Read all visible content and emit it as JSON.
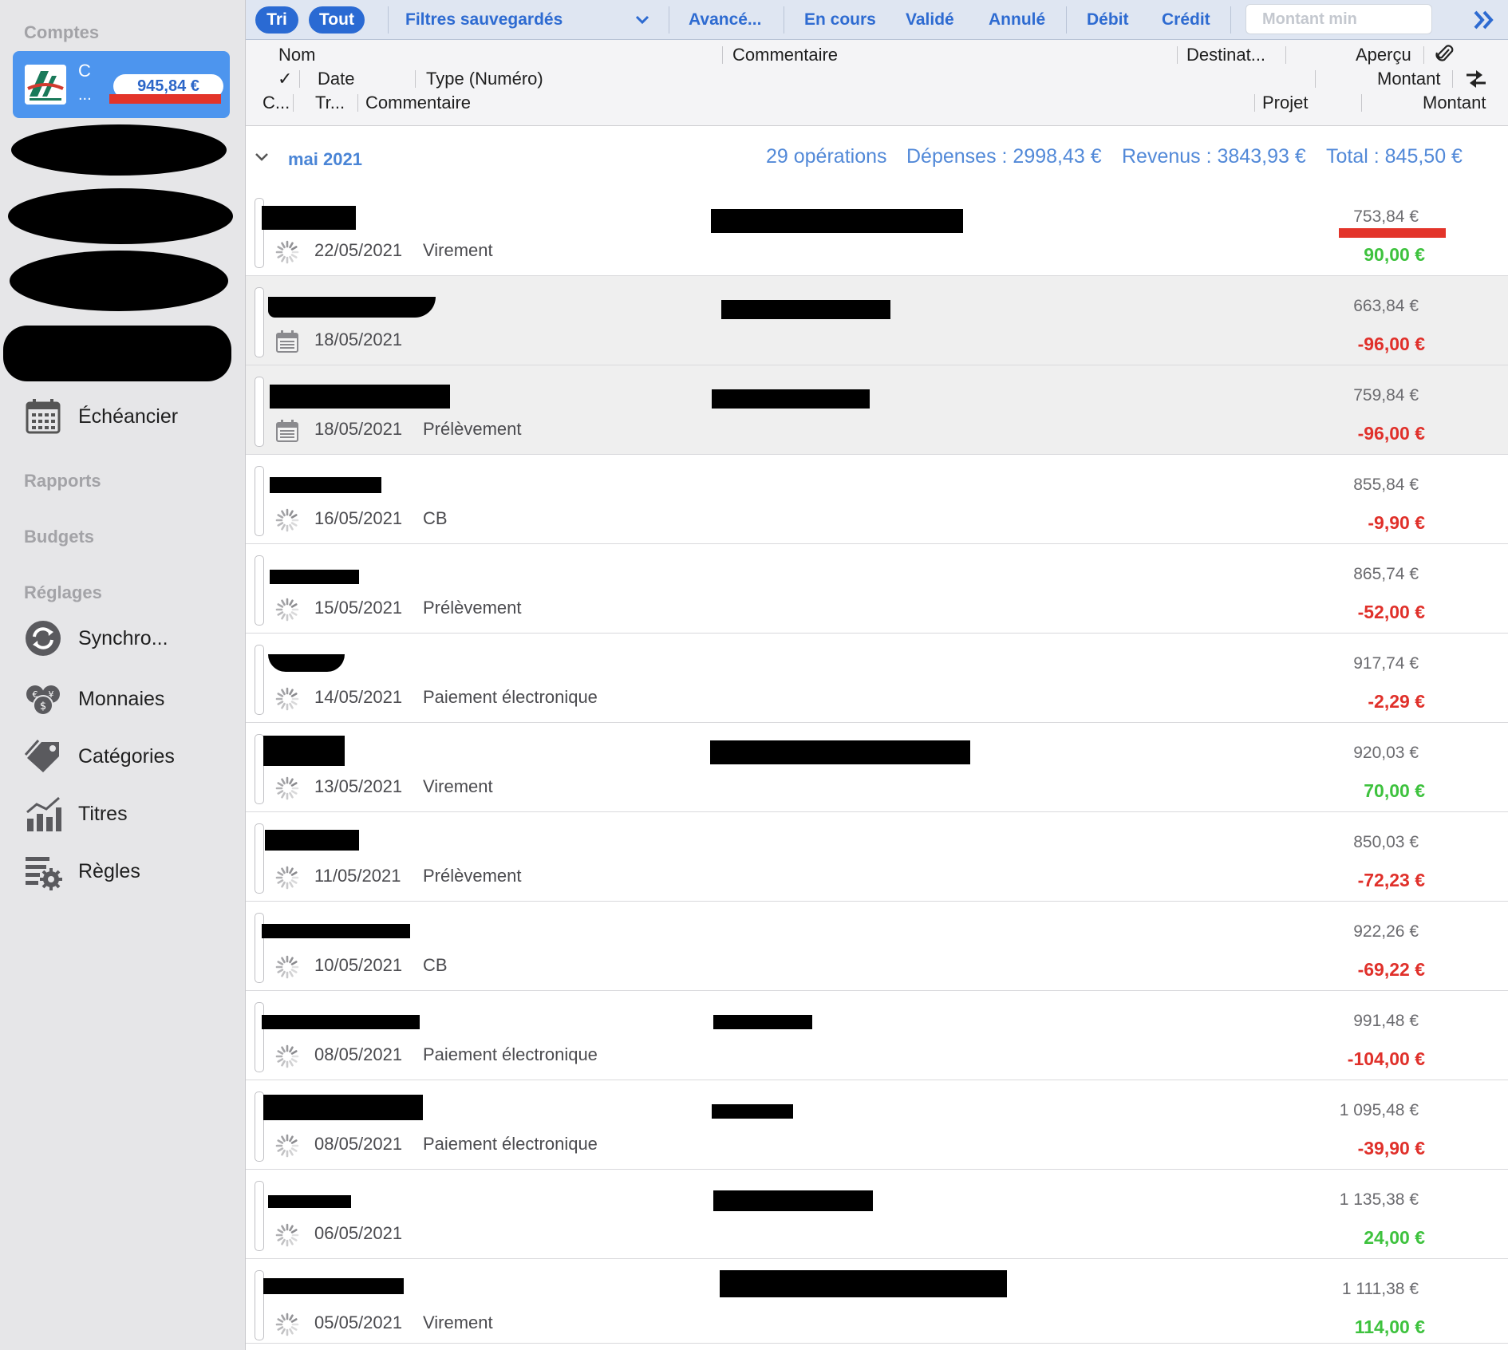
{
  "sidebar": {
    "accounts_heading": "Comptes",
    "account": {
      "name": "C",
      "more": "...",
      "balance": "945,84 €"
    },
    "scheduler_label": "Échéancier",
    "reports_heading": "Rapports",
    "budgets_heading": "Budgets",
    "settings_heading": "Réglages",
    "items": [
      {
        "label": "Synchro...",
        "icon": "sync-icon"
      },
      {
        "label": "Monnaies",
        "icon": "currencies-icon"
      },
      {
        "label": "Catégories",
        "icon": "tags-icon"
      },
      {
        "label": "Titres",
        "icon": "securities-chart-icon"
      },
      {
        "label": "Règles",
        "icon": "rules-gear-icon"
      }
    ]
  },
  "toolbar": {
    "sort_label": "Tri",
    "all_label": "Tout",
    "saved_filters_label": "Filtres sauvegardés",
    "advanced_label": "Avancé...",
    "pending_label": "En cours",
    "validated_label": "Validé",
    "cancelled_label": "Annulé",
    "debit_label": "Débit",
    "credit_label": "Crédit",
    "amount_min_placeholder": "Montant min",
    "more_icon": "double-chevron-right-icon"
  },
  "columns": {
    "name": "Nom",
    "comment": "Commentaire",
    "recipient": "Destinat...",
    "preview": "Aperçu",
    "check": "✓",
    "date": "Date",
    "type_number": "Type (Numéro)",
    "amount": "Montant",
    "category_short": "C...",
    "transfer_short": "Tr...",
    "comment2": "Commentaire",
    "project": "Projet",
    "amount2": "Montant"
  },
  "month": {
    "label": "mai 2021",
    "count": "29 opérations",
    "expenses": "Dépenses : 2998,43 €",
    "income": "Revenus : 3843,93 €",
    "total": "Total : 845,50 €"
  },
  "colors": {
    "accent": "#2a6ad3",
    "negative": "#e0302a",
    "positive": "#3ec23e",
    "summary": "#5289d8"
  },
  "transactions": [
    {
      "date": "22/05/2021",
      "type": "Virement",
      "balance": "753,84 €",
      "amount": "90,00 €",
      "sign": "pos",
      "icon": "pending-spinner-icon",
      "selected": false
    },
    {
      "date": "18/05/2021",
      "type": "",
      "balance": "663,84 €",
      "amount": "-96,00 €",
      "sign": "neg",
      "icon": "calendar-icon",
      "selected": true
    },
    {
      "date": "18/05/2021",
      "type": "Prélèvement",
      "balance": "759,84 €",
      "amount": "-96,00 €",
      "sign": "neg",
      "icon": "calendar-icon",
      "selected": true
    },
    {
      "date": "16/05/2021",
      "type": "CB",
      "balance": "855,84 €",
      "amount": "-9,90 €",
      "sign": "neg",
      "icon": "pending-spinner-icon",
      "selected": false
    },
    {
      "date": "15/05/2021",
      "type": "Prélèvement",
      "balance": "865,74 €",
      "amount": "-52,00 €",
      "sign": "neg",
      "icon": "pending-spinner-icon",
      "selected": false
    },
    {
      "date": "14/05/2021",
      "type": "Paiement électronique",
      "balance": "917,74 €",
      "amount": "-2,29 €",
      "sign": "neg",
      "icon": "pending-spinner-icon",
      "selected": false
    },
    {
      "date": "13/05/2021",
      "type": "Virement",
      "balance": "920,03 €",
      "amount": "70,00 €",
      "sign": "pos",
      "icon": "pending-spinner-icon",
      "selected": false
    },
    {
      "date": "11/05/2021",
      "type": "Prélèvement",
      "balance": "850,03 €",
      "amount": "-72,23 €",
      "sign": "neg",
      "icon": "pending-spinner-icon",
      "selected": false
    },
    {
      "date": "10/05/2021",
      "type": "CB",
      "balance": "922,26 €",
      "amount": "-69,22 €",
      "sign": "neg",
      "icon": "pending-spinner-icon",
      "selected": false
    },
    {
      "date": "08/05/2021",
      "type": "Paiement électronique",
      "balance": "991,48 €",
      "amount": "-104,00 €",
      "sign": "neg",
      "icon": "pending-spinner-icon",
      "selected": false
    },
    {
      "date": "08/05/2021",
      "type": "Paiement électronique",
      "balance": "1 095,48 €",
      "amount": "-39,90 €",
      "sign": "neg",
      "icon": "pending-spinner-icon",
      "selected": false
    },
    {
      "date": "06/05/2021",
      "type": "",
      "balance": "1 135,38 €",
      "amount": "24,00 €",
      "sign": "pos",
      "icon": "pending-spinner-icon",
      "selected": false
    },
    {
      "date": "05/05/2021",
      "type": "Virement",
      "balance": "1 111,38 €",
      "amount": "114,00 €",
      "sign": "pos",
      "icon": "pending-spinner-icon",
      "selected": false
    }
  ]
}
